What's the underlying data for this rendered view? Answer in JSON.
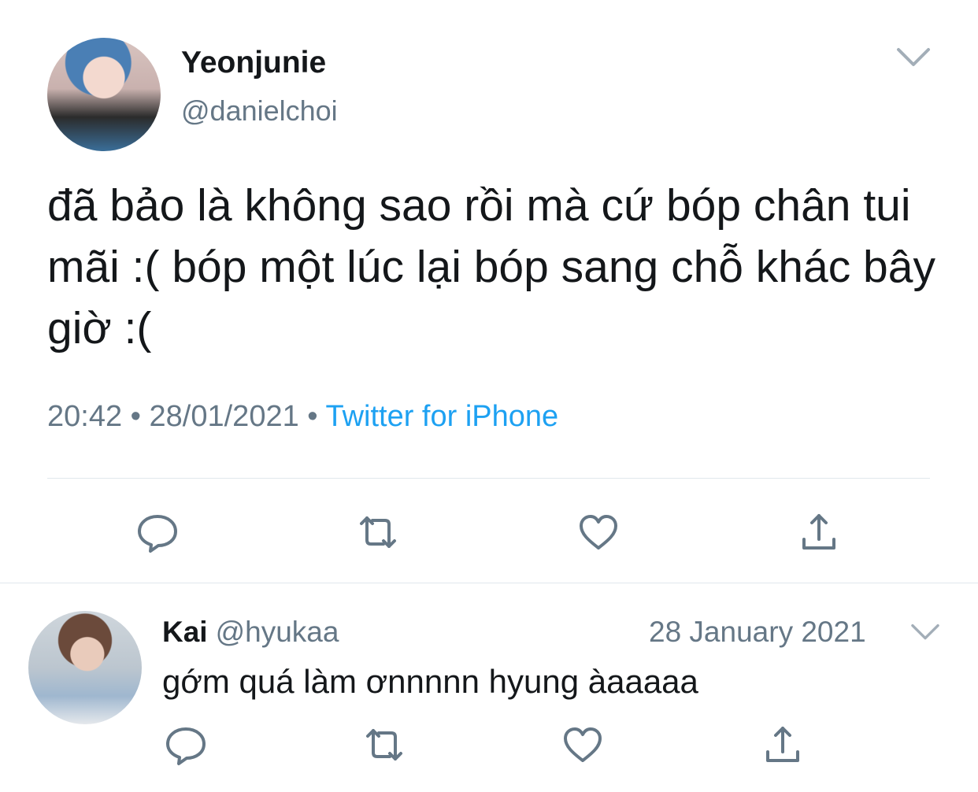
{
  "tweet": {
    "display_name": "Yeonjunie",
    "handle": "@danielchoi",
    "text": "đã bảo là không sao rồi mà cứ bóp chân tui mãi :( bóp một lúc lại bóp sang chỗ khác bây giờ :(",
    "time": "20:42",
    "date": "28/01/2021",
    "separator": "•",
    "source": "Twitter for iPhone"
  },
  "reply": {
    "display_name": "Kai",
    "handle": "@hyukaa",
    "date": "28 January 2021",
    "text": "gớm quá làm ơnnnnn hyung àaaaaa"
  },
  "actions": {
    "reply_icon": "speech-bubble-icon",
    "retweet_icon": "retweet-icon",
    "like_icon": "heart-icon",
    "share_icon": "share-icon"
  },
  "colors": {
    "link": "#1da1f2",
    "muted": "#657786",
    "icon": "#657786",
    "divider": "#e1e8ed"
  }
}
